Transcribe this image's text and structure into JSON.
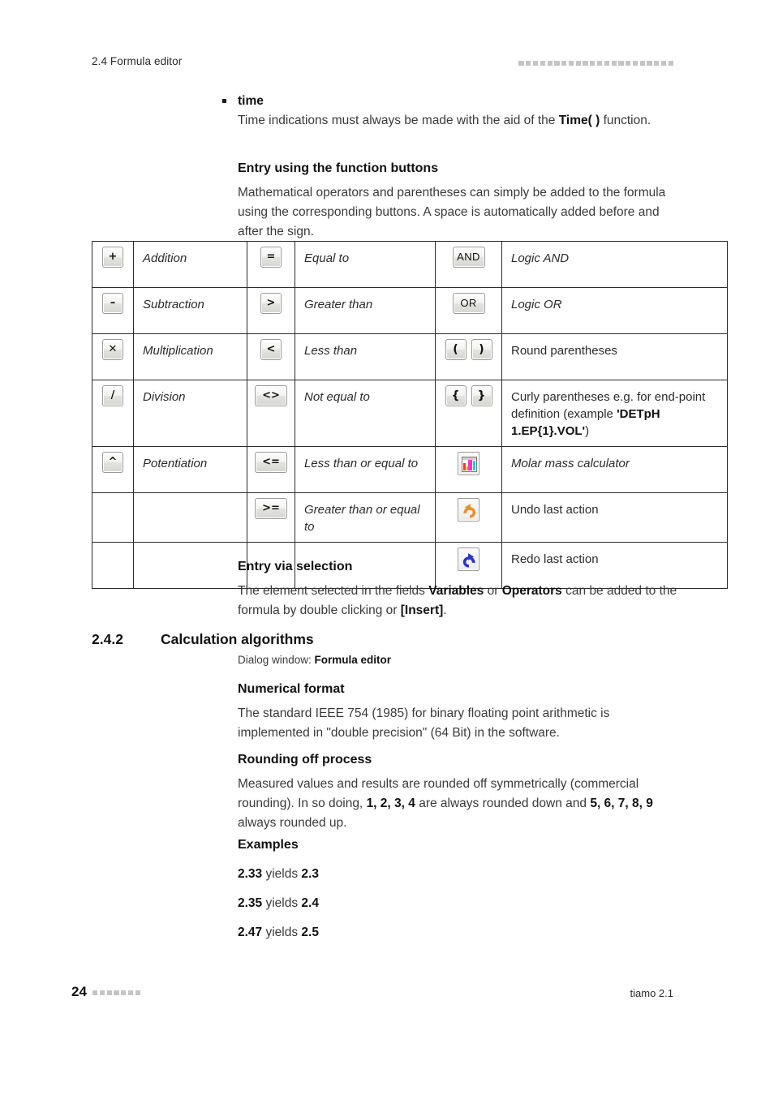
{
  "header": {
    "title": "2.4 Formula editor",
    "decoration_squares": 22
  },
  "footer": {
    "page_number": "24",
    "decoration_squares": 7,
    "product": "tiamo 2.1"
  },
  "bullet": {
    "title": "time",
    "text_part1": "Time indications must always be made with the aid of the ",
    "text_bold": "Time( )",
    "text_part2": " function."
  },
  "section_function_buttons": {
    "heading": "Entry using the function buttons",
    "paragraph": "Mathematical operators and parentheses can simply be added to the formula using the corresponding buttons. A space is automatically added before and after the sign."
  },
  "operator_table": {
    "rows": [
      {
        "icon1": "plus-button",
        "label1": "Addition",
        "icon2": "equals-button",
        "label2": "Equal to",
        "icon3": "and-button",
        "label3": "Logic AND"
      },
      {
        "icon1": "minus-button",
        "label1": "Subtraction",
        "icon2": "greater-than-button",
        "label2": "Greater than",
        "icon3": "or-button",
        "label3": "Logic OR"
      },
      {
        "icon1": "multiply-button",
        "label1": "Multiplication",
        "icon2": "less-than-button",
        "label2": "Less than",
        "icon3": "round-parentheses-buttons",
        "label3": "Round parentheses"
      },
      {
        "icon1": "divide-button",
        "label1": "Division",
        "icon2": "not-equal-button",
        "label2": "Not equal to",
        "icon3": "curly-parentheses-buttons",
        "label3_part1": "Curly parentheses e.g. for end-point definition (example ",
        "label3_bold": "'DETpH 1.EP{1}.VOL'",
        "label3_part2": ")"
      },
      {
        "icon1": "potentiation-button",
        "label1": "Potentiation",
        "icon2": "less-than-or-equal-button",
        "label2": "Less than or equal to",
        "icon3": "molar-mass-calculator-button",
        "label3": "Molar mass calculator"
      },
      {
        "icon1": "",
        "label1": "",
        "icon2": "greater-than-or-equal-button",
        "label2": "Greater than or equal to",
        "icon3": "undo-button",
        "label3": "Undo last action"
      },
      {
        "icon1": "",
        "label1": "",
        "icon2": "",
        "label2": "",
        "icon3": "redo-button",
        "label3": "Redo last action"
      }
    ],
    "button_glyphs": {
      "plus": "+",
      "minus": "–",
      "multiply": "✕",
      "divide": "/",
      "potentiation": "^",
      "equals": "=",
      "greater_than": ">",
      "less_than": "<",
      "not_equal": "<>",
      "less_or_equal": "<=",
      "greater_or_equal": ">=",
      "and": "AND",
      "or": "OR",
      "round_open": "(",
      "round_close": ")",
      "curly_open": "{",
      "curly_close": "}"
    }
  },
  "section_entry_selection": {
    "heading": "Entry via selection",
    "text_part1": "The element selected in the fields ",
    "bold1": "Variables",
    "text_part2": " or ",
    "bold2": "Operators",
    "text_part3": " can be added to the formula by double clicking or ",
    "bold3": "[Insert]",
    "text_part4": "."
  },
  "section_242": {
    "number": "2.4.2",
    "title": "Calculation algorithms",
    "dialog_prefix": "Dialog window: ",
    "dialog_bold": "Formula editor"
  },
  "section_numerical": {
    "heading": "Numerical format",
    "paragraph": "The standard IEEE 754 (1985) for binary floating point arithmetic is implemented in \"double precision\" (64 Bit) in the software."
  },
  "section_rounding": {
    "heading": "Rounding off process",
    "text_part1": "Measured values and results are rounded off symmetrically (commercial rounding). In so doing, ",
    "bold1": "1, 2, 3, 4",
    "text_part2": " are always rounded down and ",
    "bold2": "5, 6, 7, 8, 9",
    "text_part3": " always rounded up."
  },
  "section_examples": {
    "heading": "Examples",
    "items": [
      {
        "input": "2.33",
        "verb": " yields ",
        "output": "2.3"
      },
      {
        "input": "2.35",
        "verb": " yields ",
        "output": "2.4"
      },
      {
        "input": "2.47",
        "verb": " yields ",
        "output": "2.5"
      }
    ]
  },
  "colors": {
    "text": "#2b2b2b",
    "heading": "#111111",
    "decoration": "#c4c4c4",
    "undo_arrow": "#e8912a",
    "redo_arrow": "#2b33c9",
    "table_border": "#2b2b2b"
  }
}
